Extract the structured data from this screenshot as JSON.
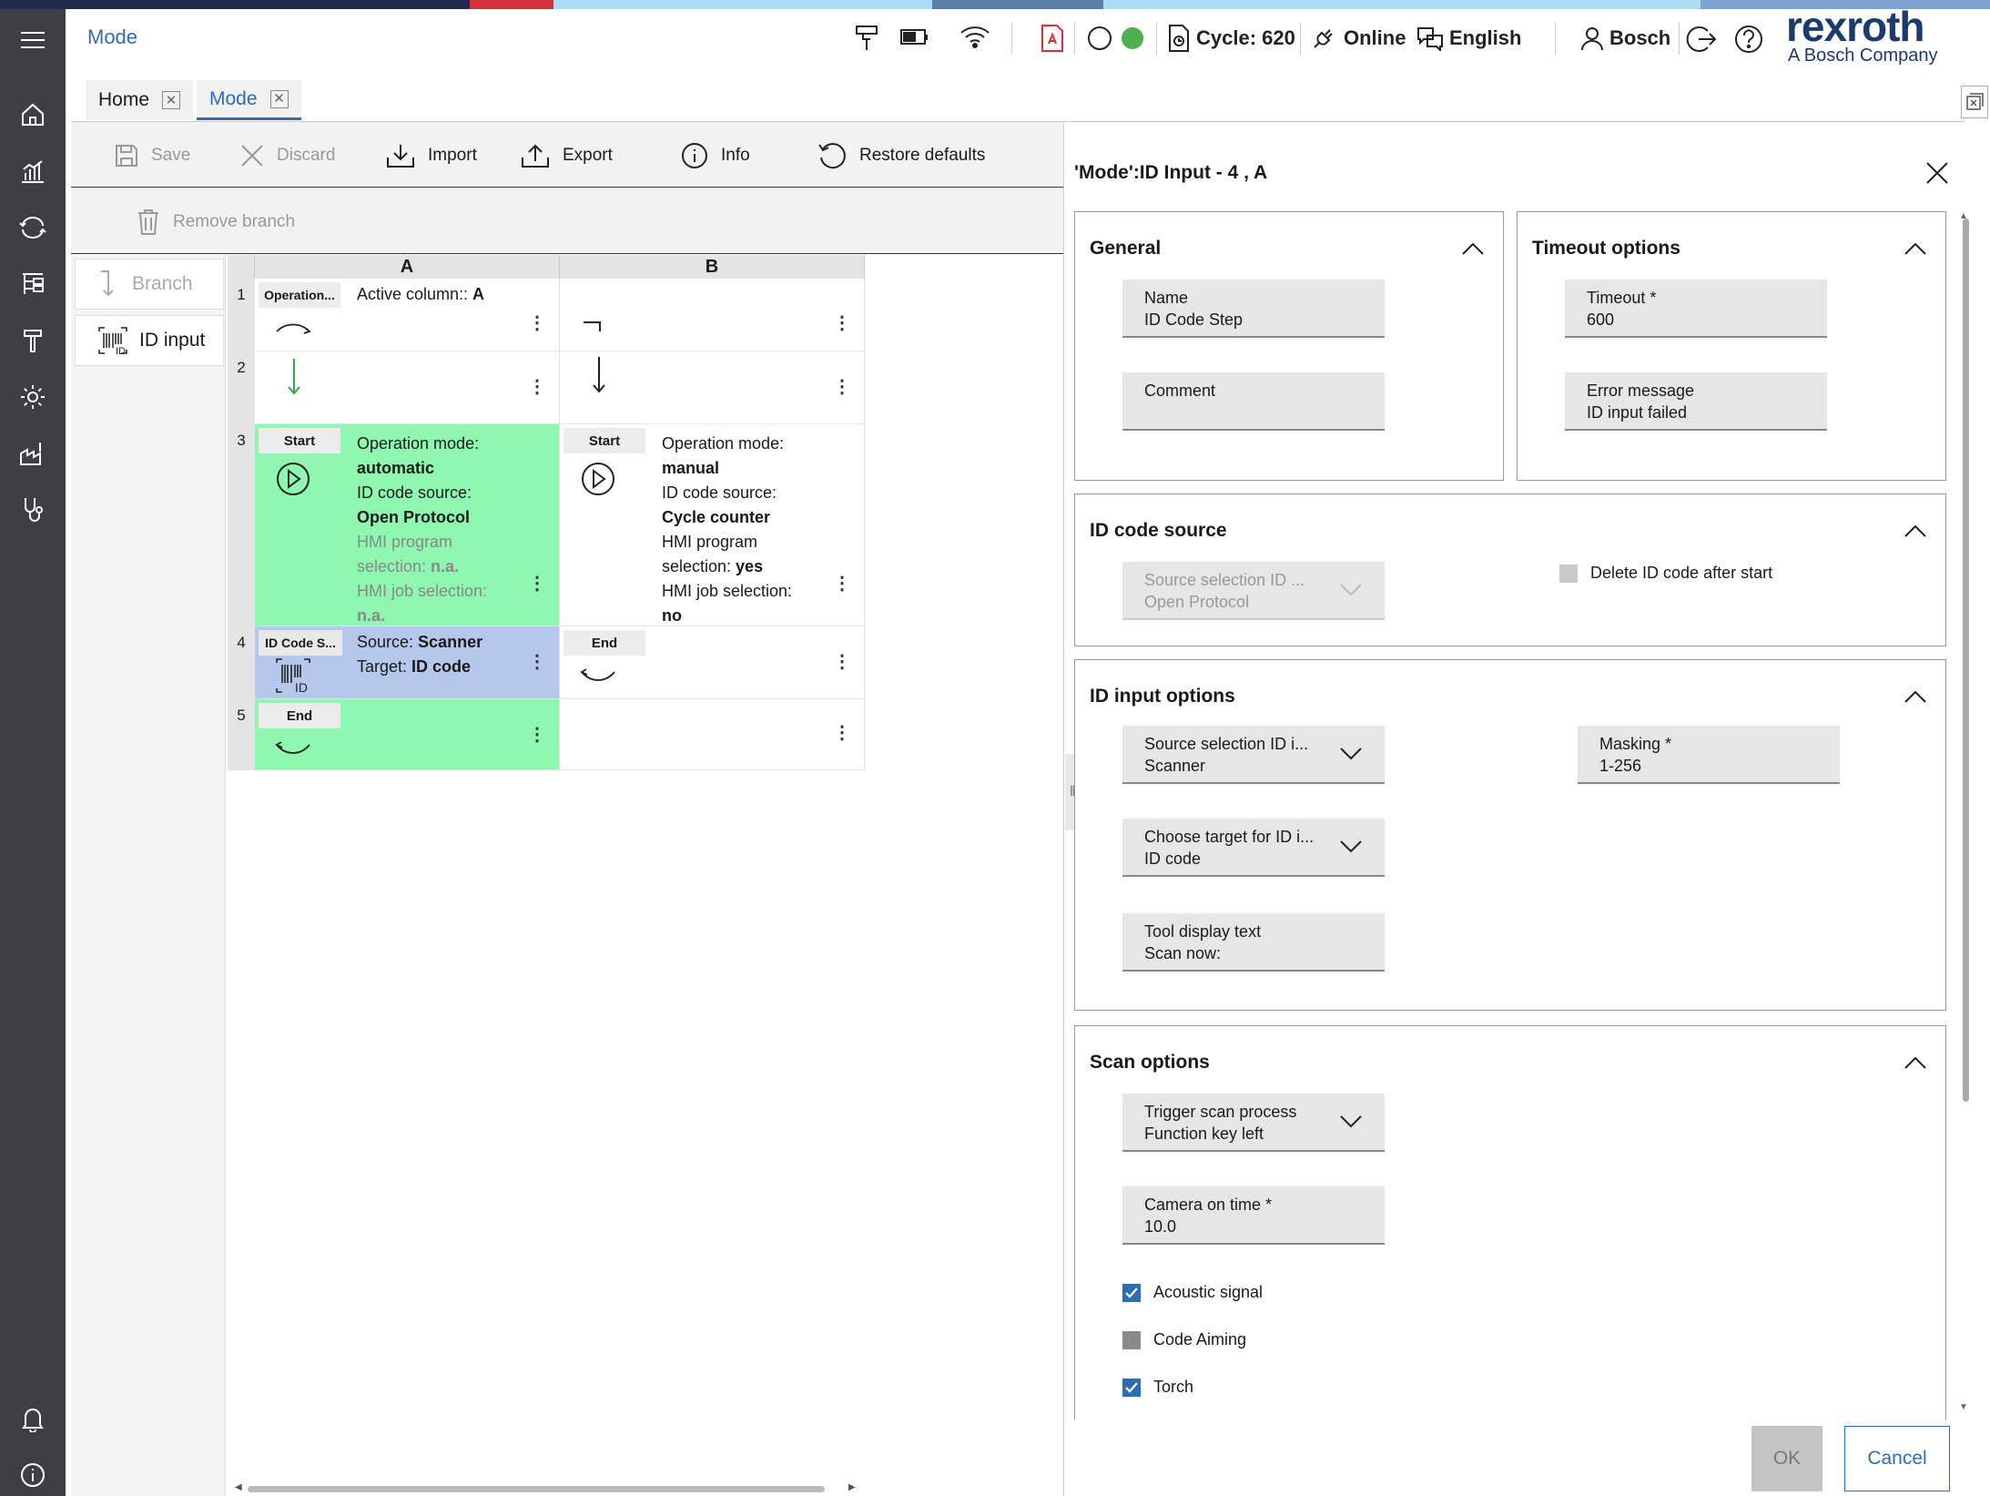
{
  "header": {
    "page_title": "Mode",
    "cycle_label": "Cycle: 620",
    "connection_label": "Online",
    "language_label": "English",
    "user_label": "Bosch",
    "brand_name": "rexroth",
    "brand_tagline": "A Bosch Company"
  },
  "tabs": [
    {
      "label": "Home",
      "active": false
    },
    {
      "label": "Mode",
      "active": true
    }
  ],
  "toolbar": {
    "save_label": "Save",
    "discard_label": "Discard",
    "import_label": "Import",
    "export_label": "Export",
    "info_label": "Info",
    "restore_label": "Restore defaults",
    "remove_branch_label": "Remove branch"
  },
  "palette": {
    "branch_label": "Branch",
    "id_input_label": "ID input"
  },
  "grid": {
    "columns": [
      "A",
      "B"
    ],
    "rows": [
      "1",
      "2",
      "3",
      "4",
      "5"
    ],
    "r1a_chip": "Operation...",
    "r1a_text_label": "Active column:: ",
    "r1a_text_value": "A",
    "r3a_chip": "Start",
    "r3a_l1": "Operation mode:",
    "r3a_l2": "automatic",
    "r3a_l3": "ID code source:",
    "r3a_l4": "Open Protocol",
    "r3a_l5": "HMI program",
    "r3a_l6a": "selection: ",
    "r3a_l6b": "n.a.",
    "r3a_l7": "HMI job selection:",
    "r3a_l8": "n.a.",
    "r3b_chip": "Start",
    "r3b_l1": "Operation mode:",
    "r3b_l2": "manual",
    "r3b_l3": "ID code source:",
    "r3b_l4": "Cycle counter",
    "r3b_l5": "HMI program",
    "r3b_l6a": "selection: ",
    "r3b_l6b": "yes",
    "r3b_l7": "HMI job selection:",
    "r3b_l8": "no",
    "r4a_chip": "ID Code S...",
    "r4a_l1a": "Source: ",
    "r4a_l1b": "Scanner",
    "r4a_l2a": "Target: ",
    "r4a_l2b": "ID code",
    "r4b_chip": "End",
    "r5a_chip": "End"
  },
  "panel": {
    "title": "'Mode':ID Input - 4 , A",
    "general": {
      "title": "General",
      "name_label": "Name",
      "name_value": "ID Code Step",
      "comment_label": "Comment",
      "comment_value": ""
    },
    "timeout": {
      "title": "Timeout options",
      "timeout_label": "Timeout *",
      "timeout_value": "600",
      "error_label": "Error message",
      "error_value": "ID input failed"
    },
    "id_source": {
      "title": "ID code source",
      "source_label": "Source selection ID ...",
      "source_value": "Open Protocol",
      "delete_label": "Delete ID code after start",
      "delete_checked": false
    },
    "id_input": {
      "title": "ID input options",
      "source_label": "Source selection ID i...",
      "source_value": "Scanner",
      "target_label": "Choose target for ID i...",
      "target_value": "ID code",
      "display_label": "Tool display text",
      "display_value": "Scan now:",
      "masking_label": "Masking *",
      "masking_value": "1-256"
    },
    "scan": {
      "title": "Scan options",
      "trigger_label": "Trigger scan process",
      "trigger_value": "Function key left",
      "camera_label": "Camera on time *",
      "camera_value": "10.0",
      "acoustic_label": "Acoustic signal",
      "acoustic_checked": true,
      "aiming_label": "Code Aiming",
      "aiming_checked": false,
      "torch_label": "Torch",
      "torch_checked": true
    },
    "ok_label": "OK",
    "cancel_label": "Cancel"
  },
  "colors": {
    "accent": "#2f6db3",
    "green_cell": "#8ef7b0",
    "blue_cell": "#b5c8ec",
    "rail": "#3d3f44",
    "status_green": "#4caf50"
  }
}
